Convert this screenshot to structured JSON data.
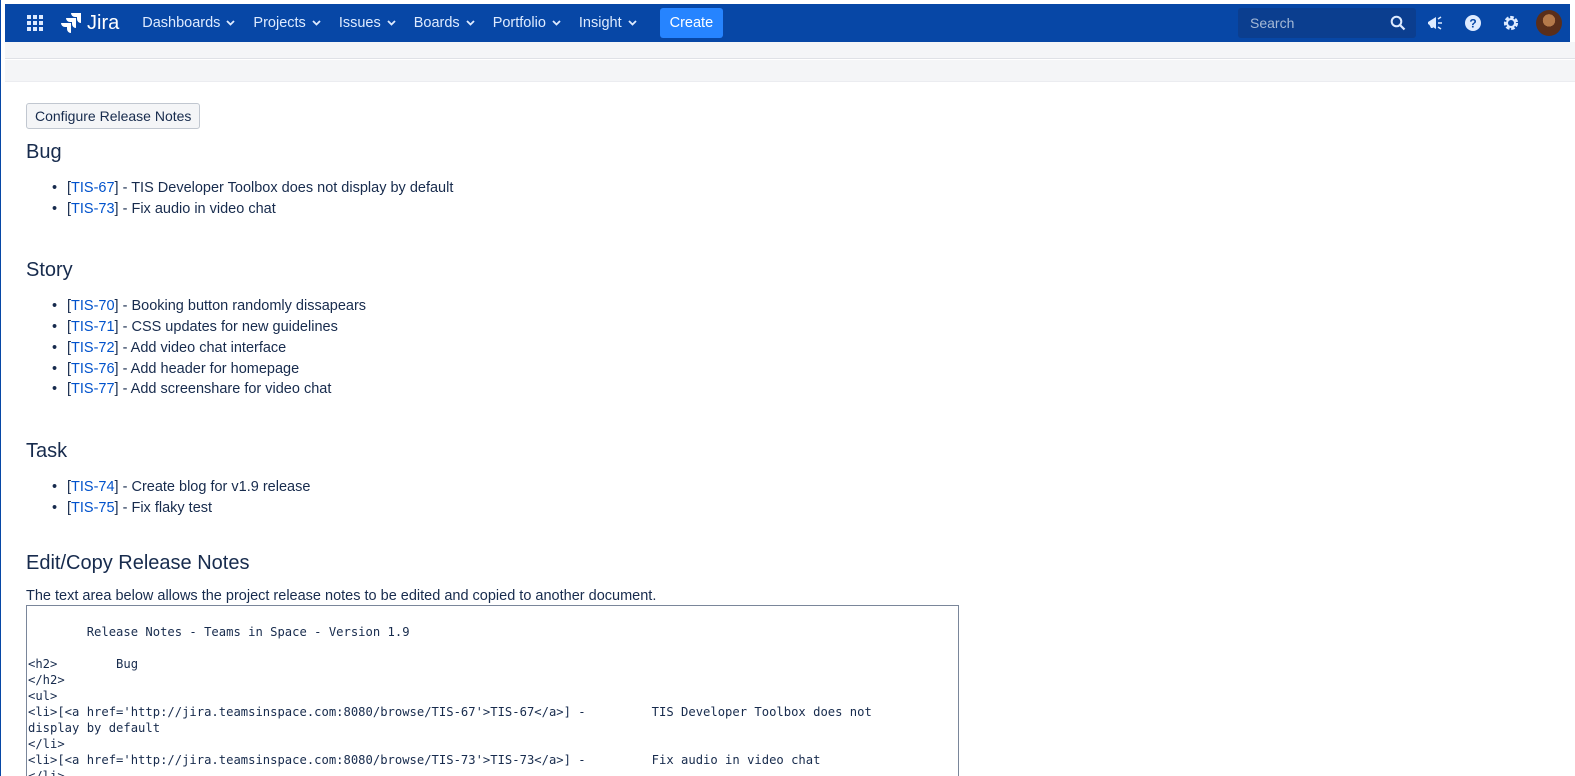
{
  "nav": {
    "logo_text": "Jira",
    "items": [
      {
        "label": "Dashboards"
      },
      {
        "label": "Projects"
      },
      {
        "label": "Issues"
      },
      {
        "label": "Boards"
      },
      {
        "label": "Portfolio"
      },
      {
        "label": "Insight"
      }
    ],
    "create_label": "Create",
    "search_placeholder": "Search",
    "icons": [
      "app-switcher-icon",
      "jira-logo-icon",
      "notifications-icon",
      "help-icon",
      "settings-icon",
      "avatar"
    ],
    "colors": {
      "bar": "#0747a6",
      "create": "#2684ff"
    }
  },
  "main": {
    "configure_button": "Configure Release Notes",
    "sections": [
      {
        "title": "Bug",
        "items": [
          {
            "key": "TIS-67",
            "summary": "TIS Developer Toolbox does not display by default"
          },
          {
            "key": "TIS-73",
            "summary": "Fix audio in video chat"
          }
        ]
      },
      {
        "title": "Story",
        "items": [
          {
            "key": "TIS-70",
            "summary": "Booking button randomly dissapears"
          },
          {
            "key": "TIS-71",
            "summary": "CSS updates for new guidelines"
          },
          {
            "key": "TIS-72",
            "summary": "Add video chat interface"
          },
          {
            "key": "TIS-76",
            "summary": "Add header for homepage"
          },
          {
            "key": "TIS-77",
            "summary": "Add screenshare for video chat"
          }
        ]
      },
      {
        "title": "Task",
        "items": [
          {
            "key": "TIS-74",
            "summary": "Create blog for v1.9 release"
          },
          {
            "key": "TIS-75",
            "summary": "Fix flaky test"
          }
        ]
      }
    ],
    "edit_title": "Edit/Copy Release Notes",
    "edit_description": "The text area below allows the project release notes to be edited and copied to another document.",
    "textarea_lines": [
      "        Release Notes - Teams in Space - Version 1.9",
      "",
      "<h2>        Bug",
      "</h2>",
      "<ul>",
      "<li>[<a href='http://jira.teamsinspace.com:8080/browse/TIS-67'>TIS-67</a>] -         TIS Developer Toolbox does not",
      "display by default",
      "</li>",
      "<li>[<a href='http://jira.teamsinspace.com:8080/browse/TIS-73'>TIS-73</a>] -         Fix audio in video chat",
      "</li>"
    ]
  }
}
